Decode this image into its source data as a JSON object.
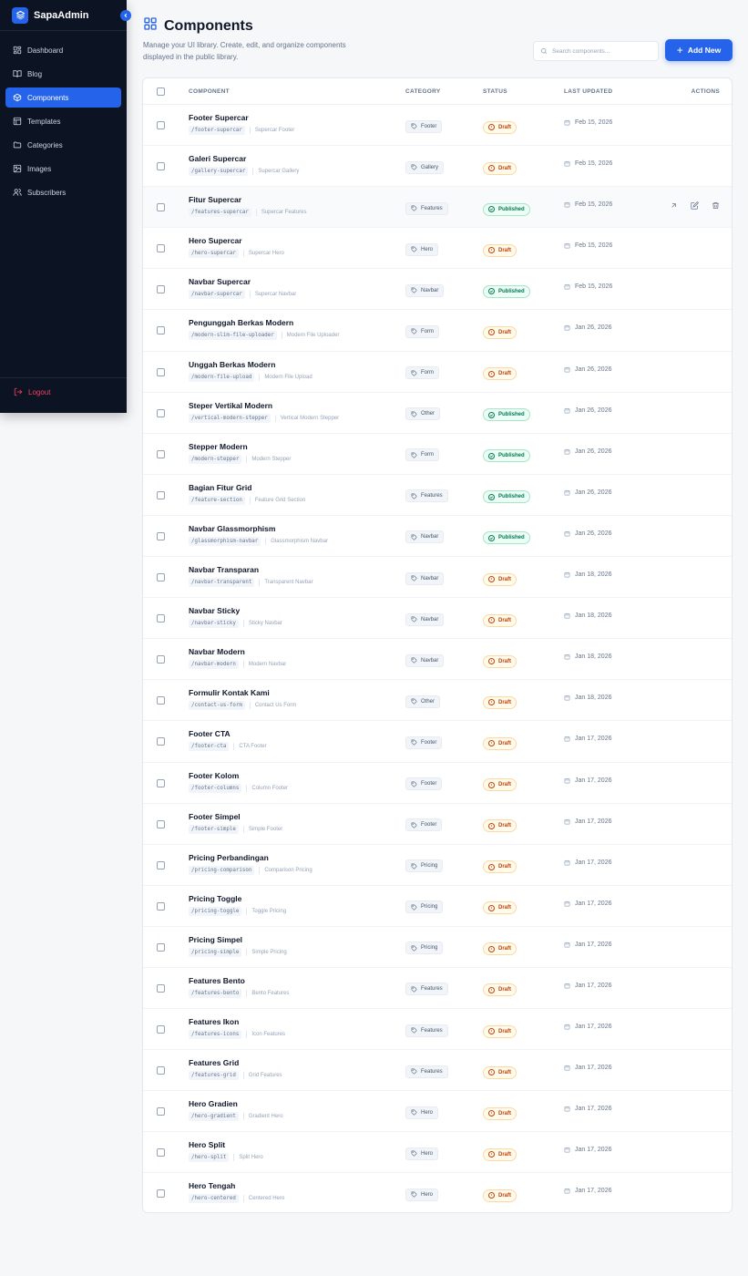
{
  "sidebar": {
    "brand": "SapaAdmin",
    "items": [
      {
        "label": "Dashboard",
        "icon": "dashboard-icon"
      },
      {
        "label": "Blog",
        "icon": "book-icon"
      },
      {
        "label": "Components",
        "icon": "box-icon",
        "active": true
      },
      {
        "label": "Templates",
        "icon": "layout-icon"
      },
      {
        "label": "Categories",
        "icon": "folder-icon"
      },
      {
        "label": "Images",
        "icon": "image-icon"
      },
      {
        "label": "Subscribers",
        "icon": "users-icon"
      }
    ],
    "logout": "Logout"
  },
  "header": {
    "title": "Components",
    "subtitle": "Manage your UI library. Create, edit, and organize components displayed in the public library.",
    "search_placeholder": "Search components...",
    "add_button": "Add New"
  },
  "table": {
    "columns": [
      "Component",
      "Category",
      "Status",
      "Last Updated",
      "Actions"
    ],
    "rows": [
      {
        "name": "Footer Supercar",
        "slug": "/footer-supercar",
        "desc": "Supercar Footer",
        "category": "Footer",
        "status": "Draft",
        "updated": "Feb 15, 2026"
      },
      {
        "name": "Galeri Supercar",
        "slug": "/gallery-supercar",
        "desc": "Supercar Gallery",
        "category": "Gallery",
        "status": "Draft",
        "updated": "Feb 15, 2026"
      },
      {
        "name": "Fitur Supercar",
        "slug": "/features-supercar",
        "desc": "Supercar Features",
        "category": "Features",
        "status": "Published",
        "updated": "Feb 15, 2026",
        "hover": true
      },
      {
        "name": "Hero Supercar",
        "slug": "/hero-supercar",
        "desc": "Supercar Hero",
        "category": "Hero",
        "status": "Draft",
        "updated": "Feb 15, 2026"
      },
      {
        "name": "Navbar Supercar",
        "slug": "/navbar-supercar",
        "desc": "Supercar Navbar",
        "category": "Navbar",
        "status": "Published",
        "updated": "Feb 15, 2026"
      },
      {
        "name": "Pengunggah Berkas Modern",
        "slug": "/modern-slim-file-uploader",
        "desc": "Modern File Uploader",
        "category": "Form",
        "status": "Draft",
        "updated": "Jan 26, 2026"
      },
      {
        "name": "Unggah Berkas Modern",
        "slug": "/modern-file-upload",
        "desc": "Modern File Upload",
        "category": "Form",
        "status": "Draft",
        "updated": "Jan 26, 2026"
      },
      {
        "name": "Steper Vertikal Modern",
        "slug": "/vertical-modern-stepper",
        "desc": "Vertical Modern Stepper",
        "category": "Other",
        "status": "Published",
        "updated": "Jan 26, 2026"
      },
      {
        "name": "Stepper Modern",
        "slug": "/modern-stepper",
        "desc": "Modern Stepper",
        "category": "Form",
        "status": "Published",
        "updated": "Jan 26, 2026"
      },
      {
        "name": "Bagian Fitur Grid",
        "slug": "/feature-section",
        "desc": "Feature Grid Section",
        "category": "Features",
        "status": "Published",
        "updated": "Jan 26, 2026"
      },
      {
        "name": "Navbar Glassmorphism",
        "slug": "/glassmorphism-navbar",
        "desc": "Glassmorphism Navbar",
        "category": "Navbar",
        "status": "Published",
        "updated": "Jan 26, 2026"
      },
      {
        "name": "Navbar Transparan",
        "slug": "/navbar-transparent",
        "desc": "Transparent Navbar",
        "category": "Navbar",
        "status": "Draft",
        "updated": "Jan 18, 2026"
      },
      {
        "name": "Navbar Sticky",
        "slug": "/navbar-sticky",
        "desc": "Sticky Navbar",
        "category": "Navbar",
        "status": "Draft",
        "updated": "Jan 18, 2026"
      },
      {
        "name": "Navbar Modern",
        "slug": "/navbar-modern",
        "desc": "Modern Navbar",
        "category": "Navbar",
        "status": "Draft",
        "updated": "Jan 18, 2026"
      },
      {
        "name": "Formulir Kontak Kami",
        "slug": "/contact-us-form",
        "desc": "Contact Us Form",
        "category": "Other",
        "status": "Draft",
        "updated": "Jan 18, 2026"
      },
      {
        "name": "Footer CTA",
        "slug": "/footer-cta",
        "desc": "CTA Footer",
        "category": "Footer",
        "status": "Draft",
        "updated": "Jan 17, 2026"
      },
      {
        "name": "Footer Kolom",
        "slug": "/footer-columns",
        "desc": "Column Footer",
        "category": "Footer",
        "status": "Draft",
        "updated": "Jan 17, 2026"
      },
      {
        "name": "Footer Simpel",
        "slug": "/footer-simple",
        "desc": "Simple Footer",
        "category": "Footer",
        "status": "Draft",
        "updated": "Jan 17, 2026"
      },
      {
        "name": "Pricing Perbandingan",
        "slug": "/pricing-comparison",
        "desc": "Comparison Pricing",
        "category": "Pricing",
        "status": "Draft",
        "updated": "Jan 17, 2026"
      },
      {
        "name": "Pricing Toggle",
        "slug": "/pricing-toggle",
        "desc": "Toggle Pricing",
        "category": "Pricing",
        "status": "Draft",
        "updated": "Jan 17, 2026"
      },
      {
        "name": "Pricing Simpel",
        "slug": "/pricing-simple",
        "desc": "Simple Pricing",
        "category": "Pricing",
        "status": "Draft",
        "updated": "Jan 17, 2026"
      },
      {
        "name": "Features Bento",
        "slug": "/features-bento",
        "desc": "Bento Features",
        "category": "Features",
        "status": "Draft",
        "updated": "Jan 17, 2026"
      },
      {
        "name": "Features Ikon",
        "slug": "/features-icons",
        "desc": "Icon Features",
        "category": "Features",
        "status": "Draft",
        "updated": "Jan 17, 2026"
      },
      {
        "name": "Features Grid",
        "slug": "/features-grid",
        "desc": "Grid Features",
        "category": "Features",
        "status": "Draft",
        "updated": "Jan 17, 2026"
      },
      {
        "name": "Hero Gradien",
        "slug": "/hero-gradient",
        "desc": "Gradient Hero",
        "category": "Hero",
        "status": "Draft",
        "updated": "Jan 17, 2026"
      },
      {
        "name": "Hero Split",
        "slug": "/hero-split",
        "desc": "Split Hero",
        "category": "Hero",
        "status": "Draft",
        "updated": "Jan 17, 2026"
      },
      {
        "name": "Hero Tengah",
        "slug": "/hero-centered",
        "desc": "Centered Hero",
        "category": "Hero",
        "status": "Draft",
        "updated": "Jan 17, 2026"
      }
    ]
  },
  "colors": {
    "accent": "#2563eb",
    "sidebar_bg": "#0c1322",
    "draft": "#c2410c",
    "published": "#047857",
    "logout": "#f43f5e"
  }
}
